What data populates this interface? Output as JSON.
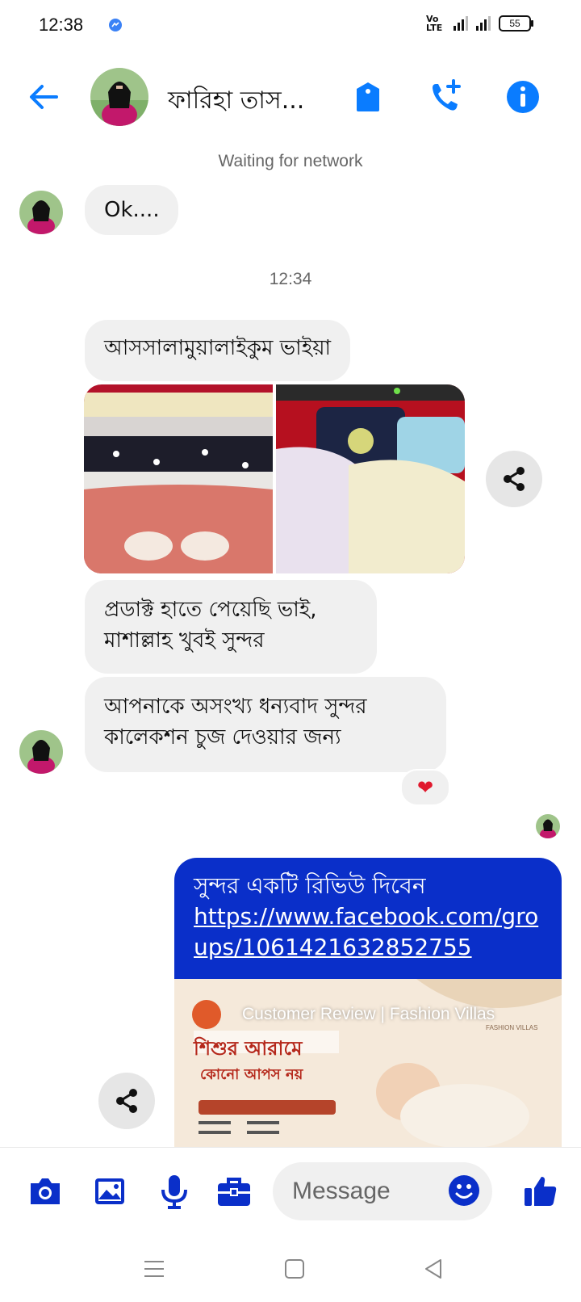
{
  "status_bar": {
    "time": "12:38",
    "network_label": "Vo LTE",
    "battery": "55"
  },
  "header": {
    "contact_name": "ফারিহা তাস..."
  },
  "conversation": {
    "network_status": "Waiting for network",
    "time_divider": "12:34",
    "messages": [
      {
        "text": "Ok...."
      },
      {
        "text": "আসসালামুয়ালাইকুম ভাইয়া"
      },
      {
        "text": "প্রডাক্ট হাতে পেয়েছি ভাই,\nমাশাল্লাহ খুবই সুন্দর"
      },
      {
        "text": "আপনাকে অসংখ্য ধন্যবাদ সুন্দর\nকালেকশন চুজ দেওয়ার জন্য"
      }
    ],
    "reaction": "❤",
    "sent": {
      "text": "সুন্দর একটি রিভিউ দিবেন",
      "link": "https://www.facebook.com/groups/1061421632852755"
    },
    "link_preview": {
      "title": "Customer Review | Fashion Villas",
      "headline_line1": "শিশুর আরামে",
      "headline_line2": "কোনো আপস নয়",
      "brand": "FASHION VILLAS"
    }
  },
  "composer": {
    "placeholder": "Message"
  },
  "colors": {
    "accent": "#0a7cff",
    "sent_bubble": "#0a2fc9",
    "icon_blue": "#0a2fc9",
    "bubble_gray": "#f0f0f0"
  }
}
